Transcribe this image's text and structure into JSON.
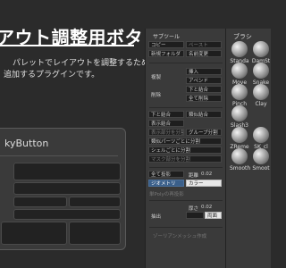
{
  "hero": {
    "title": "アウト調整用ボタン",
    "desc1": "パレットでレイアウトを調整するための",
    "desc2": "追加するプラグインです。"
  },
  "palette": {
    "title": "kyButton"
  },
  "subtool": {
    "header": "サブツール",
    "copy": "コピー",
    "paste": "ペースト",
    "new_folder": "新規フォルダ",
    "rename": "名前変更",
    "duplicate": "複製",
    "insert": "挿入",
    "append": "アペンド",
    "delete": "削除",
    "merge_down": "下と結合",
    "delete_all": "全て削除",
    "merge_down2": "下と結合",
    "merge_similar": "類似結合",
    "merge_visible": "表示結合",
    "split_hidden": "表示部分を分割",
    "groups_split": "グループ分割",
    "split_similar": "類似パーツごとに分割",
    "split_shells": "シェルごとに分割",
    "split_masked": "マスク部分を分割",
    "project_all": "全て投影",
    "distance": "距離",
    "distance_value": "0.02",
    "geometry": "ジオメトリ",
    "color": "カラー",
    "project_misc": "単Polyの再投影",
    "extract": "抽出",
    "thickness": "厚さ",
    "thickness_value": "0.02",
    "both_sides": "両面",
    "footer": "ゾーリアンメッシュ作成"
  },
  "brush": {
    "header": "ブラシ",
    "items": [
      {
        "name": "Standa"
      },
      {
        "name": "DamSt"
      },
      {
        "name": "Move"
      },
      {
        "name": "Snake"
      },
      {
        "name": "Pinch"
      },
      {
        "name": "Clay"
      },
      {
        "name": "Slash3"
      },
      {
        "name": "ZReme"
      },
      {
        "name": "SK_cl"
      },
      {
        "name": "Smooth"
      },
      {
        "name": "Smoot"
      }
    ]
  }
}
